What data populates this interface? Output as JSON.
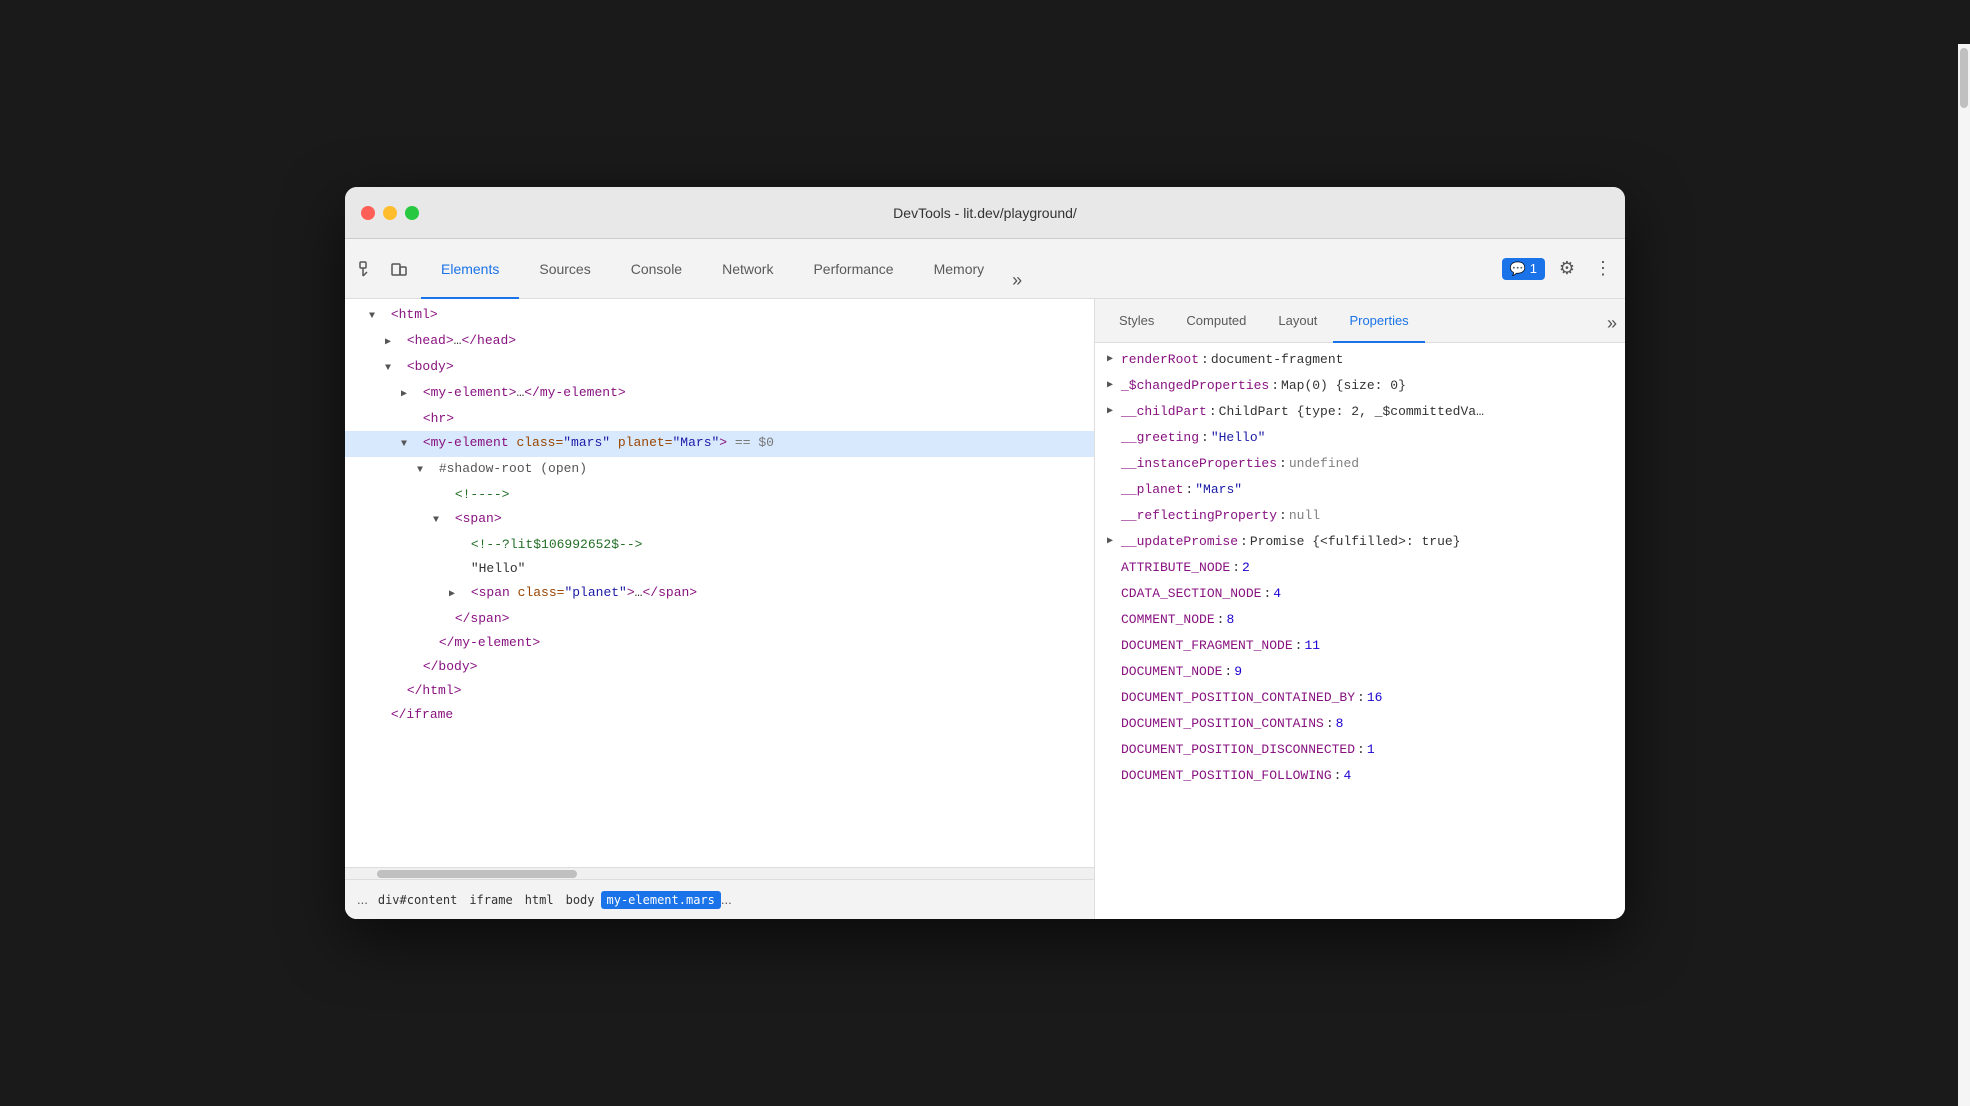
{
  "window": {
    "title": "DevTools - lit.dev/playground/"
  },
  "tabs": {
    "items": [
      {
        "label": "Elements",
        "active": true
      },
      {
        "label": "Sources",
        "active": false
      },
      {
        "label": "Console",
        "active": false
      },
      {
        "label": "Network",
        "active": false
      },
      {
        "label": "Performance",
        "active": false
      },
      {
        "label": "Memory",
        "active": false
      }
    ],
    "more_label": "»",
    "comment_badge": "💬 1",
    "gear_icon": "⚙",
    "more_icon": "⋮"
  },
  "left_panel": {
    "sub_tabs": [
      {
        "label": "Styles"
      },
      {
        "label": "Computed"
      },
      {
        "label": "Layout"
      },
      {
        "label": "Properties",
        "active": true
      }
    ],
    "dom_lines": [
      {
        "indent": 1,
        "triangle": "open",
        "content_html": "<span class='tag'>&lt;html&gt;</span>",
        "selected": false
      },
      {
        "indent": 2,
        "triangle": "closed",
        "content_html": "<span class='tag'>&lt;head&gt;</span><span class='text-content'>…</span><span class='tag'>&lt;/head&gt;</span>",
        "selected": false
      },
      {
        "indent": 2,
        "triangle": "open",
        "content_html": "<span class='tag'>&lt;body&gt;</span>",
        "selected": false
      },
      {
        "indent": 3,
        "triangle": "closed",
        "content_html": "<span class='tag'>&lt;my-element&gt;</span><span class='text-content'>…</span><span class='tag'>&lt;/my-element&gt;</span>",
        "selected": false
      },
      {
        "indent": 3,
        "triangle": "empty",
        "content_html": "<span class='tag'>&lt;hr&gt;</span>",
        "selected": false
      },
      {
        "indent": 3,
        "triangle": "open",
        "content_html": "<span class='tag'>&lt;my-element </span><span class='attr-name'>class=</span><span class='attr-value'>\"mars\"</span><span class='tag'> </span><span class='attr-name'>planet=</span><span class='attr-value'>\"Mars\"</span><span class='tag'>&gt;</span><span class='selected-indicator'> == $0</span>",
        "selected": true,
        "highlighted": true
      },
      {
        "indent": 4,
        "triangle": "open",
        "content_html": "<span class='pseudo-element'>#shadow-root (open)</span>",
        "selected": false
      },
      {
        "indent": 5,
        "triangle": "empty",
        "content_html": "<span class='comment'>&lt;!----&gt;</span>",
        "selected": false
      },
      {
        "indent": 5,
        "triangle": "open",
        "content_html": "<span class='tag'>&lt;span&gt;</span>",
        "selected": false
      },
      {
        "indent": 6,
        "triangle": "empty",
        "content_html": "<span class='comment'>&lt;!--?lit$106992652$--&gt;</span>",
        "selected": false
      },
      {
        "indent": 6,
        "triangle": "empty",
        "content_html": "<span class='text-content'>\"Hello\"</span>",
        "selected": false
      },
      {
        "indent": 6,
        "triangle": "closed",
        "content_html": "<span class='tag'>&lt;span </span><span class='attr-name'>class=</span><span class='attr-value'>\"planet\"</span><span class='tag'>&gt;</span><span class='text-content'>…</span><span class='tag'>&lt;/span&gt;</span>",
        "selected": false
      },
      {
        "indent": 5,
        "triangle": "empty",
        "content_html": "<span class='tag'>&lt;/span&gt;</span>",
        "selected": false
      },
      {
        "indent": 4,
        "triangle": "empty",
        "content_html": "<span class='tag'>&lt;/my-element&gt;</span>",
        "selected": false
      },
      {
        "indent": 3,
        "triangle": "empty",
        "content_html": "<span class='tag'>&lt;/body&gt;</span>",
        "selected": false
      },
      {
        "indent": 2,
        "triangle": "empty",
        "content_html": "<span class='tag'>&lt;/html&gt;</span>",
        "selected": false
      },
      {
        "indent": 1,
        "triangle": "empty",
        "content_html": "<span class='tag'>&lt;/iframe&gt;</span>",
        "selected": false
      }
    ],
    "breadcrumb": {
      "more": "...",
      "items": [
        {
          "label": "div#content",
          "active": false
        },
        {
          "label": "iframe",
          "active": false
        },
        {
          "label": "html",
          "active": false
        },
        {
          "label": "body",
          "active": false
        },
        {
          "label": "my-element.mars",
          "active": true
        }
      ],
      "more_end": "..."
    }
  },
  "right_panel": {
    "sub_tabs": [
      {
        "label": "Styles",
        "active": false
      },
      {
        "label": "Computed",
        "active": false
      },
      {
        "label": "Layout",
        "active": false
      },
      {
        "label": "Properties",
        "active": true
      }
    ],
    "more_label": "»",
    "properties": [
      {
        "expand": "open",
        "name": "renderRoot",
        "colon": ":",
        "value": "document-fragment",
        "value_type": "text"
      },
      {
        "expand": "open",
        "name": "_$changedProperties",
        "colon": ":",
        "value": "Map(0) {size: 0}",
        "value_type": "text"
      },
      {
        "expand": "open",
        "name": "__childPart",
        "colon": ":",
        "value": "ChildPart {type: 2, _$committedVa…",
        "value_type": "text"
      },
      {
        "expand": "none",
        "name": "__greeting",
        "colon": ":",
        "value": "\"Hello\"",
        "value_type": "str"
      },
      {
        "expand": "none",
        "name": "__instanceProperties",
        "colon": ":",
        "value": "undefined",
        "value_type": "null"
      },
      {
        "expand": "none",
        "name": "__planet",
        "colon": ":",
        "value": "\"Mars\"",
        "value_type": "str"
      },
      {
        "expand": "none",
        "name": "__reflectingProperty",
        "colon": ":",
        "value": "null",
        "value_type": "null"
      },
      {
        "expand": "open",
        "name": "__updatePromise",
        "colon": ":",
        "value": "Promise {<fulfilled>: true}",
        "value_type": "text"
      },
      {
        "expand": "none",
        "name": "ATTRIBUTE_NODE",
        "colon": ":",
        "value": "2",
        "value_type": "num"
      },
      {
        "expand": "none",
        "name": "CDATA_SECTION_NODE",
        "colon": ":",
        "value": "4",
        "value_type": "num"
      },
      {
        "expand": "none",
        "name": "COMMENT_NODE",
        "colon": ":",
        "value": "8",
        "value_type": "num"
      },
      {
        "expand": "none",
        "name": "DOCUMENT_FRAGMENT_NODE",
        "colon": ":",
        "value": "11",
        "value_type": "num"
      },
      {
        "expand": "none",
        "name": "DOCUMENT_NODE",
        "colon": ":",
        "value": "9",
        "value_type": "num"
      },
      {
        "expand": "none",
        "name": "DOCUMENT_POSITION_CONTAINED_BY",
        "colon": ":",
        "value": "16",
        "value_type": "num"
      },
      {
        "expand": "none",
        "name": "DOCUMENT_POSITION_CONTAINS",
        "colon": ":",
        "value": "8",
        "value_type": "num"
      },
      {
        "expand": "none",
        "name": "DOCUMENT_POSITION_DISCONNECTED",
        "colon": ":",
        "value": "1",
        "value_type": "num"
      },
      {
        "expand": "none",
        "name": "DOCUMENT_POSITION_FOLLOWING",
        "colon": ":",
        "value": "4",
        "value_type": "num"
      }
    ]
  }
}
